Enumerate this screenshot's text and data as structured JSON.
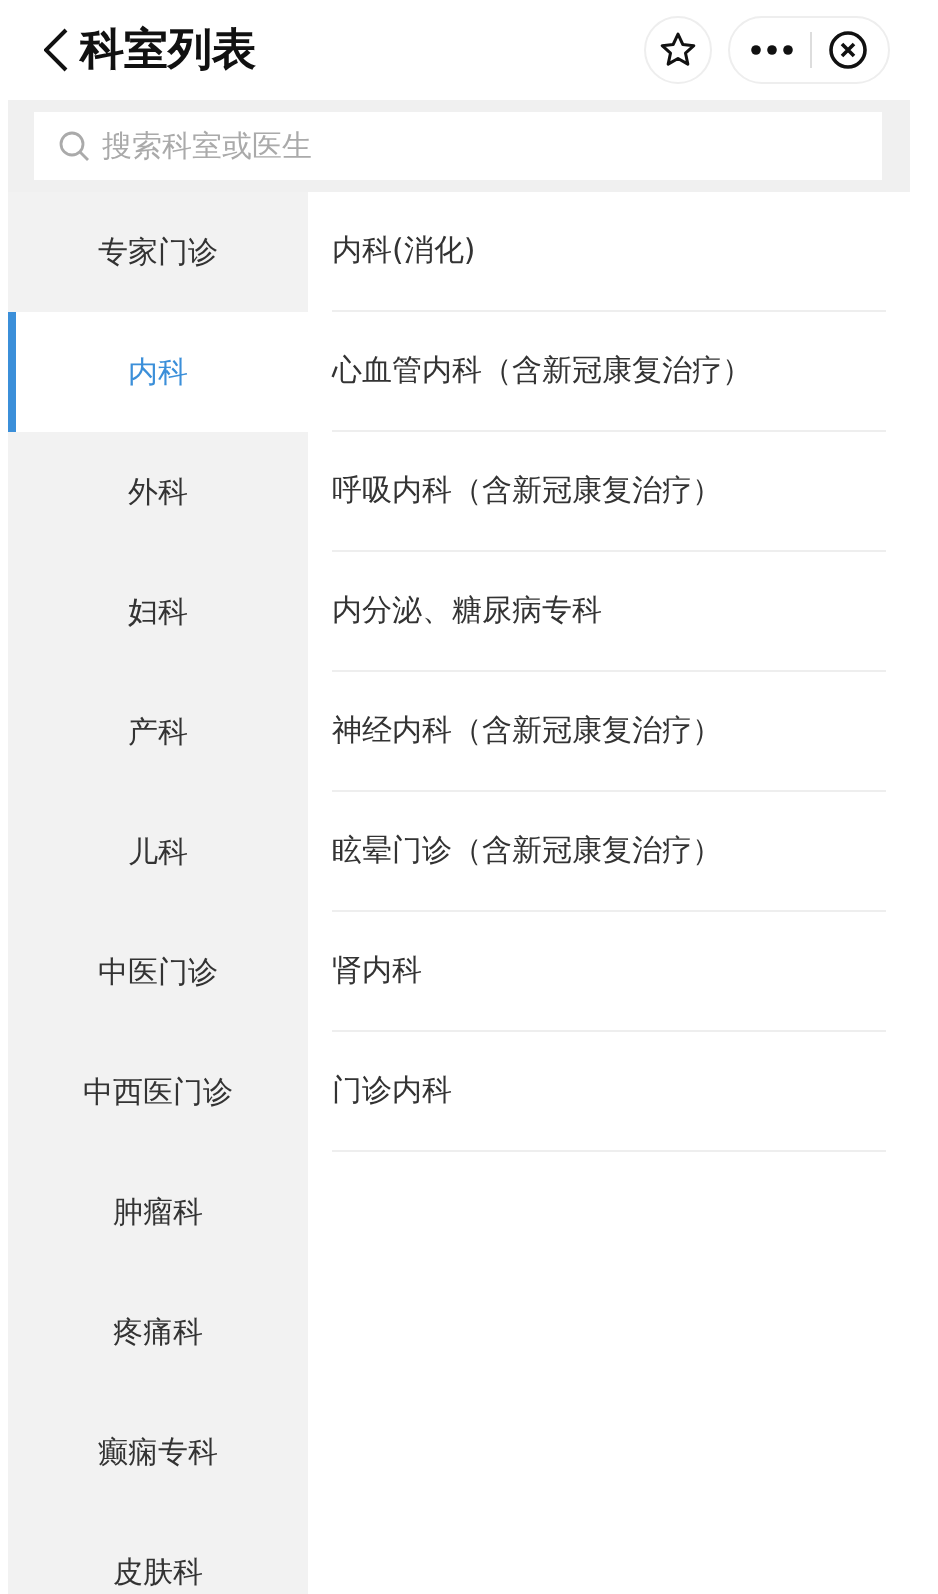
{
  "header": {
    "title": "科室列表"
  },
  "search": {
    "placeholder": "搜索科室或医生"
  },
  "categories": [
    {
      "label": "专家门诊",
      "selected": false
    },
    {
      "label": "内科",
      "selected": true
    },
    {
      "label": "外科",
      "selected": false
    },
    {
      "label": "妇科",
      "selected": false
    },
    {
      "label": "产科",
      "selected": false
    },
    {
      "label": "儿科",
      "selected": false
    },
    {
      "label": "中医门诊",
      "selected": false
    },
    {
      "label": "中西医门诊",
      "selected": false
    },
    {
      "label": "肿瘤科",
      "selected": false
    },
    {
      "label": "疼痛科",
      "selected": false
    },
    {
      "label": "癫痫专科",
      "selected": false
    },
    {
      "label": "皮肤科",
      "selected": false
    }
  ],
  "departments": [
    "内科(消化)",
    "心血管内科（含新冠康复治疗）",
    "呼吸内科（含新冠康复治疗）",
    "内分泌、糖尿病专科",
    "神经内科（含新冠康复治疗）",
    "眩晕门诊（含新冠康复治疗）",
    "肾内科",
    "门诊内科"
  ]
}
